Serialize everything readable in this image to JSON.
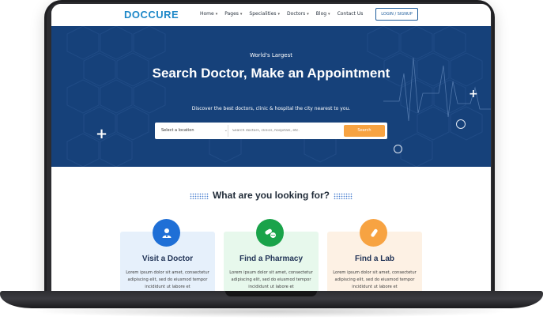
{
  "brand": {
    "logo": "DOCCURE"
  },
  "nav": {
    "items": [
      "Home",
      "Pages",
      "Specialities",
      "Doctors",
      "Blog",
      "Contact Us"
    ],
    "has_dropdown": [
      true,
      true,
      true,
      true,
      true,
      false
    ],
    "login_label": "LOGIN / SIGNUP"
  },
  "hero": {
    "subtitle": "World's Largest",
    "title": "Search Doctor, Make an Appointment",
    "description": "Discover the best doctors, clinic & hospital the city nearest to you.",
    "location_placeholder": "Select a location",
    "search_placeholder": "Search doctors, clinics, hospitals, etc.",
    "search_label": "Search",
    "bg_color": "#16417a",
    "accent_color": "#f7a342"
  },
  "section": {
    "title": "What are you looking for?"
  },
  "cards": [
    {
      "title": "Visit a Doctor",
      "icon": "doctor-icon",
      "icon_color": "#1f6fd6",
      "bg": "#e6f0fb",
      "text": "Lorem ipsum dolor sit amet, consectetur adipiscing elit, sed do eiusmod tempor incididunt ut labore et"
    },
    {
      "title": "Find a Pharmacy",
      "icon": "pill-icon",
      "icon_color": "#1aa34a",
      "bg": "#e7f8ec",
      "text": "Lorem ipsum dolor sit amet, consectetur adipiscing elit, sed do eiusmod tempor incididunt ut labore et"
    },
    {
      "title": "Find a Lab",
      "icon": "lab-tube-icon",
      "icon_color": "#f7a342",
      "bg": "#fdf1e4",
      "text": "Lorem ipsum dolor sit amet, consectetur adipiscing elit, sed do eiusmod tempor incididunt ut labore et"
    }
  ]
}
